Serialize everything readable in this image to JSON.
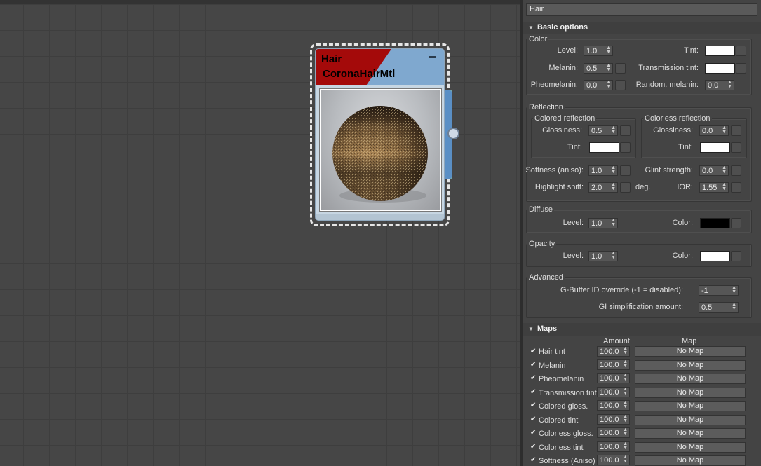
{
  "node": {
    "title": "Hair",
    "subtitle": "CoronaHairMtl"
  },
  "panel": {
    "name": "Hair",
    "basic": {
      "title": "Basic options",
      "color_group": "Color",
      "level_label": "Level:",
      "level_value": "1.0",
      "tint_label": "Tint:",
      "melanin_label": "Melanin:",
      "melanin_value": "0.5",
      "transmission_tint_label": "Transmission tint:",
      "pheomelanin_label": "Pheomelanin:",
      "pheomelanin_value": "0.0",
      "random_melanin_label": "Random. melanin:",
      "random_melanin_value": "0.0",
      "reflection_group": "Reflection",
      "colored_reflection": "Colored reflection",
      "colorless_reflection": "Colorless reflection",
      "glossiness_label": "Glossiness:",
      "colored_gloss_value": "0.5",
      "colorless_gloss_value": "0.0",
      "softness_label": "Softness (aniso):",
      "softness_value": "1.0",
      "glint_label": "Glint strength:",
      "glint_value": "0.0",
      "highlight_label": "Highlight shift:",
      "highlight_value": "2.0",
      "highlight_unit": "deg.",
      "ior_label": "IOR:",
      "ior_value": "1.55",
      "diffuse_group": "Diffuse",
      "diffuse_level_value": "1.0",
      "color_label": "Color:",
      "opacity_group": "Opacity",
      "opacity_level_value": "1.0",
      "advanced_group": "Advanced",
      "gbuffer_label": "G-Buffer ID override (-1 = disabled):",
      "gbuffer_value": "-1",
      "gi_label": "GI simplification amount:",
      "gi_value": "0.5"
    },
    "maps": {
      "title": "Maps",
      "amount_header": "Amount",
      "map_header": "Map",
      "rows": [
        {
          "label": "Hair tint",
          "amount": "100.0",
          "map": "No Map"
        },
        {
          "label": "Melanin",
          "amount": "100.0",
          "map": "No Map"
        },
        {
          "label": "Pheomelanin",
          "amount": "100.0",
          "map": "No Map"
        },
        {
          "label": "Transmission tint",
          "amount": "100.0",
          "map": "No Map"
        },
        {
          "label": "Colored gloss.",
          "amount": "100.0",
          "map": "No Map"
        },
        {
          "label": "Colored tint",
          "amount": "100.0",
          "map": "No Map"
        },
        {
          "label": "Colorless gloss.",
          "amount": "100.0",
          "map": "No Map"
        },
        {
          "label": "Colorless tint",
          "amount": "100.0",
          "map": "No Map"
        },
        {
          "label": "Softness (Aniso)",
          "amount": "100.0",
          "map": "No Map"
        }
      ]
    }
  },
  "colors": {
    "node_header_red": "#a40a0a",
    "node_header_blue": "#7fa8cf",
    "white_swatch": "#ffffff",
    "black_swatch": "#000000"
  }
}
